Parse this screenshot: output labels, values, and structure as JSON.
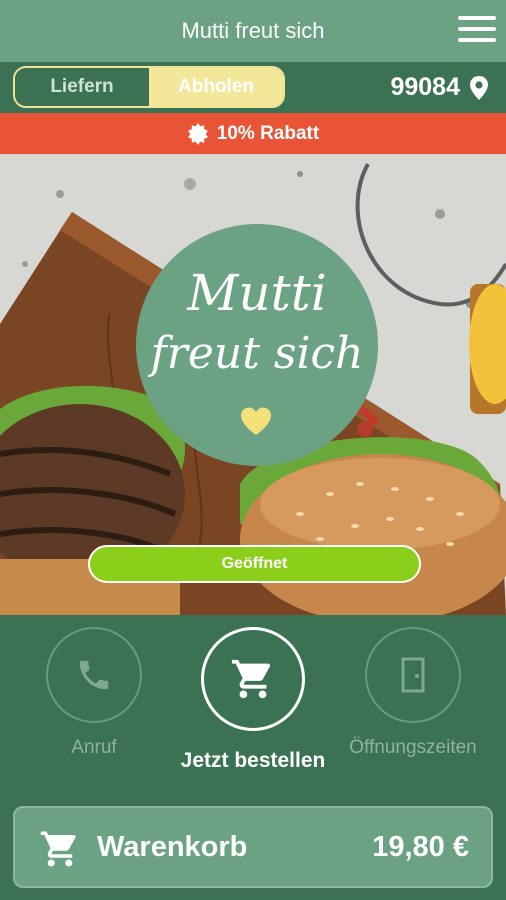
{
  "header": {
    "title": "Mutti freut sich",
    "menu_icon": "hamburger-menu-icon"
  },
  "mode_toggle": {
    "options": [
      "Liefern",
      "Abholen"
    ],
    "selected": "Abholen",
    "colors": {
      "active_bg": "#f3e89a",
      "border": "#efe49a"
    }
  },
  "location": {
    "zip": "99084",
    "icon": "map-pin-icon"
  },
  "promo": {
    "text": "10% Rabatt",
    "icon": "badge-icon",
    "color": "#ea5436"
  },
  "hero": {
    "logo_line1": "Mutti",
    "logo_line2": "freut sich",
    "logo_icon": "heart-icon",
    "status": "Geöffnet",
    "status_color": "#8ccf1b"
  },
  "actions": [
    {
      "label": "Anruf",
      "icon": "phone-icon"
    },
    {
      "label": "Jetzt bestellen",
      "icon": "cart-icon"
    },
    {
      "label": "Öffnungszeiten",
      "icon": "door-icon"
    }
  ],
  "cart": {
    "label": "Warenkorb",
    "total": "19,80 €",
    "icon": "cart-icon"
  },
  "colors": {
    "brand_green": "#6ba284",
    "dark_green": "#3c7254"
  }
}
